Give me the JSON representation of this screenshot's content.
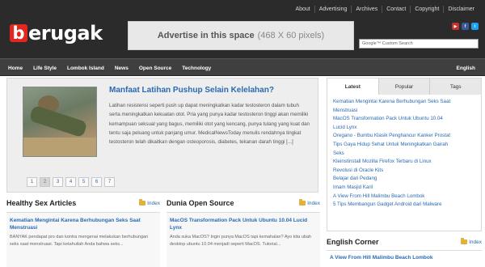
{
  "top_links": [
    "About",
    "Advertising",
    "Archives",
    "Contact",
    "Copyright",
    "Disclaimer"
  ],
  "logo": {
    "text": "erugak",
    "mark_letter": "b"
  },
  "ad": {
    "main": "Advertise in this space",
    "size": "(468 X 60 pixels)"
  },
  "social_icons": [
    {
      "name": "youtube-icon",
      "glyph": "▶",
      "color": "#c4302b"
    },
    {
      "name": "facebook-icon",
      "glyph": "f",
      "color": "#3b5998"
    },
    {
      "name": "twitter-icon",
      "glyph": "t",
      "color": "#1da1f2"
    }
  ],
  "search": {
    "placeholder": "Google™ Custom Search"
  },
  "nav": {
    "items": [
      "Home",
      "Life Style",
      "Lombok Island",
      "News",
      "Open Source",
      "Technology"
    ],
    "right": "English"
  },
  "feature": {
    "title": "Manfaat Latihan Pushup Selain Kelelahan?",
    "text": "Latihan resistensi seperti push up dapat meningkatkan kadar testosteron dalam tubuh serta meningkatkan kekuatan otot. Pria yang punya kadar testosteron tinggi akan memiliki kemampuan seksual yang bagus, memiliki otot yang kencang, punya tulang yang kuat dan tentu saja peluang untuk panjang umur. MedicalNewsToday menulis rendahnya tingkat testosteron telah dikaitkan dengan osteoporosis, diabetes, tekanan darah tinggi [...]",
    "pages": [
      "1",
      "2",
      "3",
      "4",
      "5",
      "6",
      "7"
    ],
    "active_page": "2"
  },
  "sections": [
    {
      "heading": "Healthy Sex Articles",
      "index_label": "Index",
      "post_title": "Kematian Mengintai Karena Berhubungan Seks Saat Menstruasi",
      "post_excerpt": "BANYAK pendapat pro dan kontra mengenai melakukan berhubungan seks saat menstruasi. Tapi ketahuilah Anda bahwa seks..."
    },
    {
      "heading": "Dunia Open Source",
      "index_label": "Index",
      "post_title": "MacOS Transformation Pack Untuk Ubuntu 10.04 Lucid Lynx",
      "post_excerpt": "Anda suka MacOS? Ingin punya MacOS tapi kemahalan? Ayo kita ubah desktop ubuntu 10.04 menjadi seperti MacOS. Tutorial..."
    }
  ],
  "sidebar": {
    "tabs": [
      "Latest",
      "Popular",
      "Tags"
    ],
    "latest": [
      "Kematian Mengintai Karena Berhubungan Seks Saat",
      "Menstruasi",
      "MacOS Transformation Pack Untuk Ubuntu 10.04",
      "Lucid Lynx",
      "Oregano - Bumbu Klasik Penghancur Kanker Prostat",
      "Tips Gaya Hidup Sehat Untuk Meningkatkan Gairah",
      "Seks",
      "Kleinstinstall Mozilla Firefox Terbaru di Linux",
      "Revolusi di Oracle Kits",
      "Belajar dari Pedang",
      "Imam Masjid Karil",
      "A View From Hill Malimbu Beach Lombok",
      "5 Tips Membangun Gadget Android dari Malware"
    ]
  },
  "english_corner": {
    "heading": "English Corner",
    "index_label": "Index",
    "post_title": "A View From Hill Malimbu Beach Lombok"
  }
}
